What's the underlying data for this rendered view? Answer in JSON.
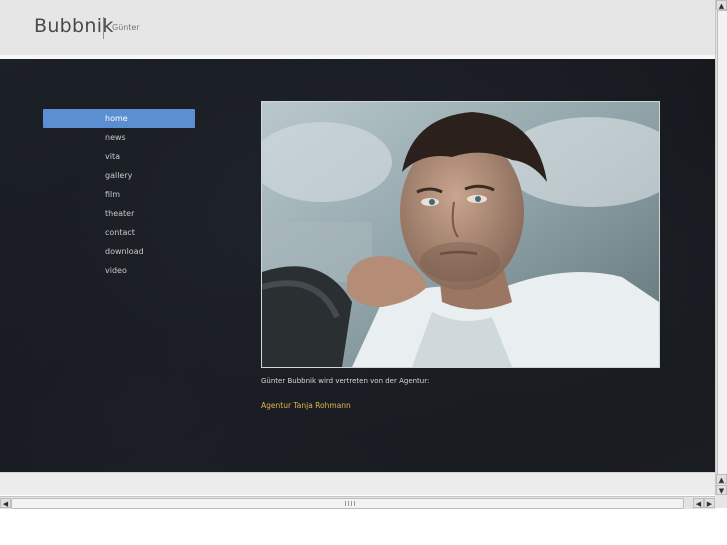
{
  "site": {
    "brand": "Bubbnik",
    "sub": "Günter"
  },
  "nav": {
    "items": [
      {
        "label": "home",
        "active": true
      },
      {
        "label": "news"
      },
      {
        "label": "vita"
      },
      {
        "label": "gallery"
      },
      {
        "label": "film"
      },
      {
        "label": "theater"
      },
      {
        "label": "contact"
      },
      {
        "label": "download"
      },
      {
        "label": "video"
      }
    ]
  },
  "main": {
    "caption": "Günter Bubbnik wird vertreten von der Agentur:",
    "agency_link": "Agentur Tanja Rohmann"
  },
  "colors": {
    "nav_active": "#5b8fd1",
    "link": "#e0b64a",
    "background": "#15181d"
  },
  "icons": {
    "scroll_up": "▲",
    "scroll_down": "▼",
    "scroll_left": "◀",
    "scroll_right": "▶"
  }
}
